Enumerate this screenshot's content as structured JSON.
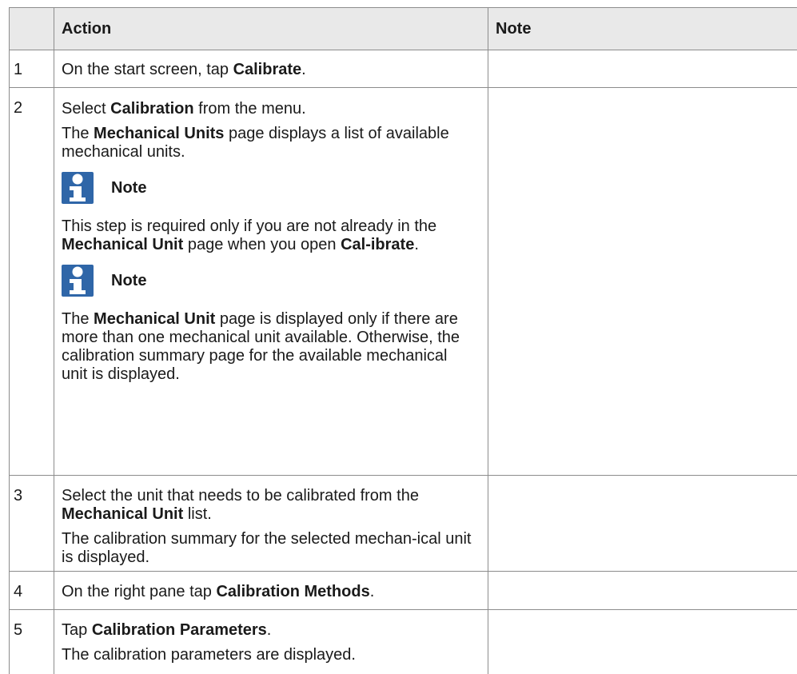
{
  "table": {
    "headers": {
      "step": "",
      "action": "Action",
      "note": "Note"
    },
    "rows": [
      {
        "num": "1",
        "p1": {
          "a": "On the start screen, tap ",
          "b": "Calibrate",
          "c": "."
        }
      },
      {
        "num": "2",
        "p1": {
          "a": "Select ",
          "b": "Calibration",
          "c": " from the menu."
        },
        "p2": {
          "a": "The ",
          "b": "Mechanical Units",
          "c": " page displays a list of available mechanical units."
        },
        "note1_label": "Note",
        "p3": {
          "a": "This step is required only if you are not already in the ",
          "b": "Mechanical Unit",
          "c": " page when you open ",
          "d": "Cal-ibrate",
          "e": "."
        },
        "note2_label": "Note",
        "p4": {
          "a": "The ",
          "b": "Mechanical Unit",
          "c": " page is displayed only if there are more than one mechanical unit available. Otherwise, the calibration summary page for the available mechanical unit is displayed."
        }
      },
      {
        "num": "3",
        "p1": {
          "a": "Select the unit that needs to be calibrated from the ",
          "b": "Mechanical Unit",
          "c": " list."
        },
        "p2": "The calibration summary for the selected mechan-ical unit is displayed."
      },
      {
        "num": "4",
        "p1": {
          "a": "On the right pane tap ",
          "b": "Calibration Methods",
          "c": "."
        }
      },
      {
        "num": "5",
        "p1": {
          "a": "Tap ",
          "b": "Calibration Parameters",
          "c": "."
        },
        "p2": "The calibration parameters are displayed."
      }
    ]
  },
  "colors": {
    "header_bg": "#e9e9e9",
    "border": "#8c8c8c",
    "note_icon": "#2f66a8"
  },
  "icons": {
    "note": "info-person-icon"
  }
}
